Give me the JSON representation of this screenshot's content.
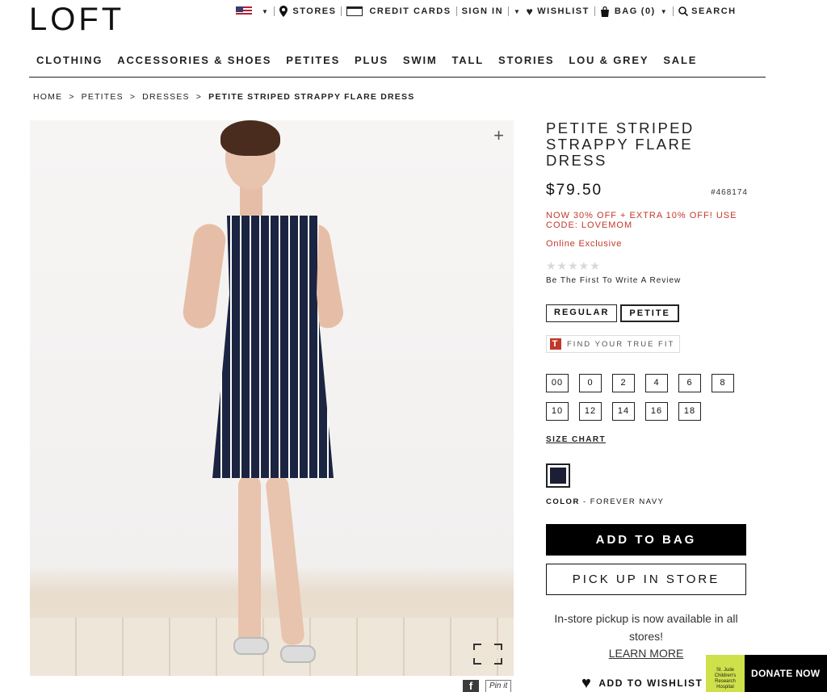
{
  "brand": {
    "logo": "LOFT"
  },
  "utility": {
    "country_flag": "us-flag-icon",
    "stores": "STORES",
    "credit_cards": "CREDIT CARDS",
    "sign_in": "SIGN IN",
    "wishlist": "WISHLIST",
    "bag": "BAG",
    "bag_count": "(0)",
    "search": "SEARCH"
  },
  "nav": {
    "items": [
      "CLOTHING",
      "ACCESSORIES & SHOES",
      "PETITES",
      "PLUS",
      "SWIM",
      "TALL",
      "STORIES",
      "LOU & GREY",
      "SALE"
    ]
  },
  "breadcrumb": {
    "items": [
      "HOME",
      "PETITES",
      "DRESSES"
    ],
    "separator": ">",
    "current": "PETITE STRIPED STRAPPY FLARE DRESS"
  },
  "gallery": {
    "thumbnails_count": 3,
    "active_index": 0
  },
  "product": {
    "title": "PETITE STRIPED STRAPPY FLARE DRESS",
    "price": "$79.50",
    "sku": "#468174",
    "promo": "NOW 30% OFF + EXTRA 10% OFF! USE CODE: LOVEMOM",
    "exclusive": "Online Exclusive",
    "stars": "★★★★★",
    "review_cta": "Be The First To Write A Review",
    "fit_options": [
      "REGULAR",
      "PETITE"
    ],
    "selected_fit": "PETITE",
    "true_fit": "FIND YOUR TRUE FIT",
    "true_fit_logo": "T",
    "sizes": [
      "00",
      "0",
      "2",
      "4",
      "6",
      "8",
      "10",
      "12",
      "14",
      "16",
      "18"
    ],
    "size_chart": "SIZE CHART",
    "color_label": "COLOR",
    "color_separator": "-",
    "color_name": "FOREVER NAVY",
    "color_hex": "#1a1f36",
    "add_to_bag": "ADD TO BAG",
    "pick_up": "PICK UP IN STORE",
    "pickup_note": "In-store pickup is now available in all stores!",
    "learn_more": "LEARN MORE",
    "add_to_wishlist": "ADD TO WISHLIST"
  },
  "share": {
    "facebook": "f",
    "pinterest": "Pin it"
  },
  "donate": {
    "label": "DONATE NOW",
    "partner": "St. Jude Children's Research Hospital"
  },
  "colors": {
    "accent_red": "#c0392b",
    "navy": "#1b2440"
  }
}
